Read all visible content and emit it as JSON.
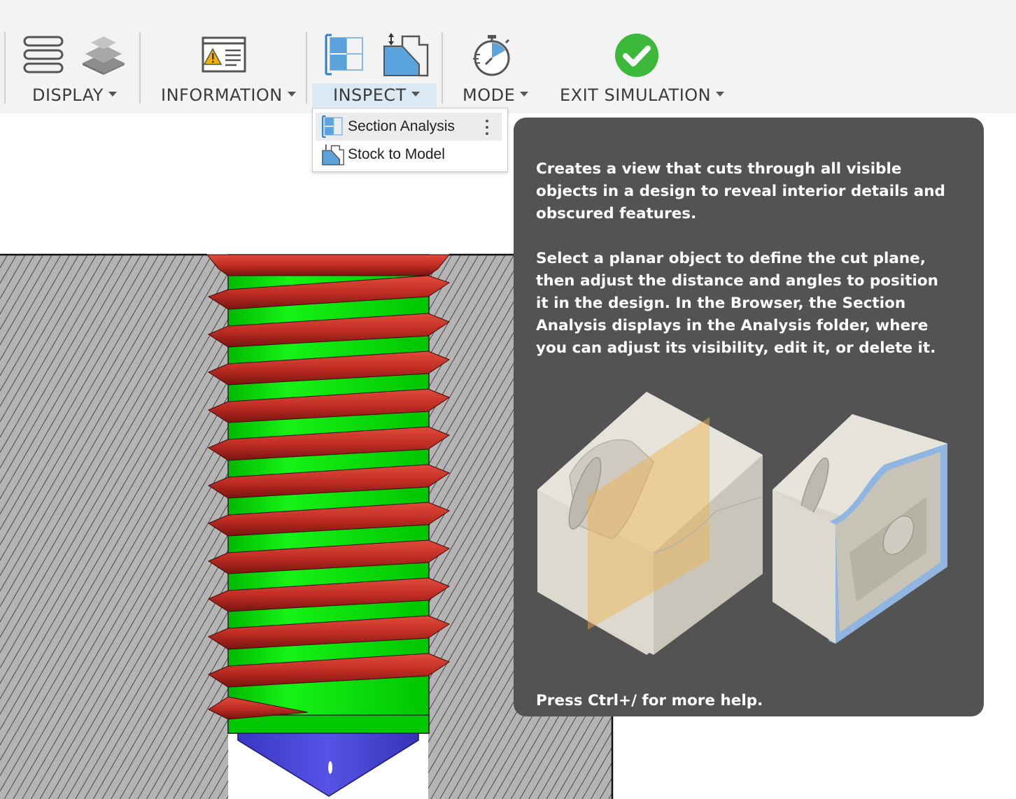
{
  "toolbar": {
    "groups": [
      {
        "label": "DISPLAY",
        "icons": [
          "layers-icon",
          "stack-icon"
        ]
      },
      {
        "label": "INFORMATION",
        "icons": [
          "warning-panel-icon"
        ]
      },
      {
        "label": "INSPECT",
        "icons": [
          "section-analysis-icon",
          "stock-to-model-icon"
        ],
        "active": true
      },
      {
        "label": "MODE",
        "icons": [
          "stopwatch-icon"
        ]
      },
      {
        "label": "EXIT SIMULATION",
        "icons": [
          "checkmark-icon"
        ]
      }
    ]
  },
  "dropdown": {
    "items": [
      {
        "label": "Section Analysis",
        "icon": "section-analysis-icon",
        "highlighted": true
      },
      {
        "label": "Stock to Model",
        "icon": "stock-to-model-icon"
      }
    ]
  },
  "tooltip": {
    "paragraph1": "Creates a view that cuts through all visible objects in a design to reveal interior details and obscured features.",
    "paragraph2": "Select a planar object to define the cut plane, then adjust the distance and angles to position it in the design. In the Browser, the Section Analysis displays in the Analysis folder, where you can adjust its visibility, edit it, or delete it.",
    "footer": "Press Ctrl+/ for more help."
  },
  "colors": {
    "toolbar_bg": "#f3f3f3",
    "active_group": "#dbe9f5",
    "tooltip_bg": "#535353",
    "thread_red": "#c8302a",
    "thread_green": "#00e000",
    "tip_blue": "#4a47d8",
    "check_green": "#3cb83a",
    "icon_blue": "#5ba3dc"
  }
}
